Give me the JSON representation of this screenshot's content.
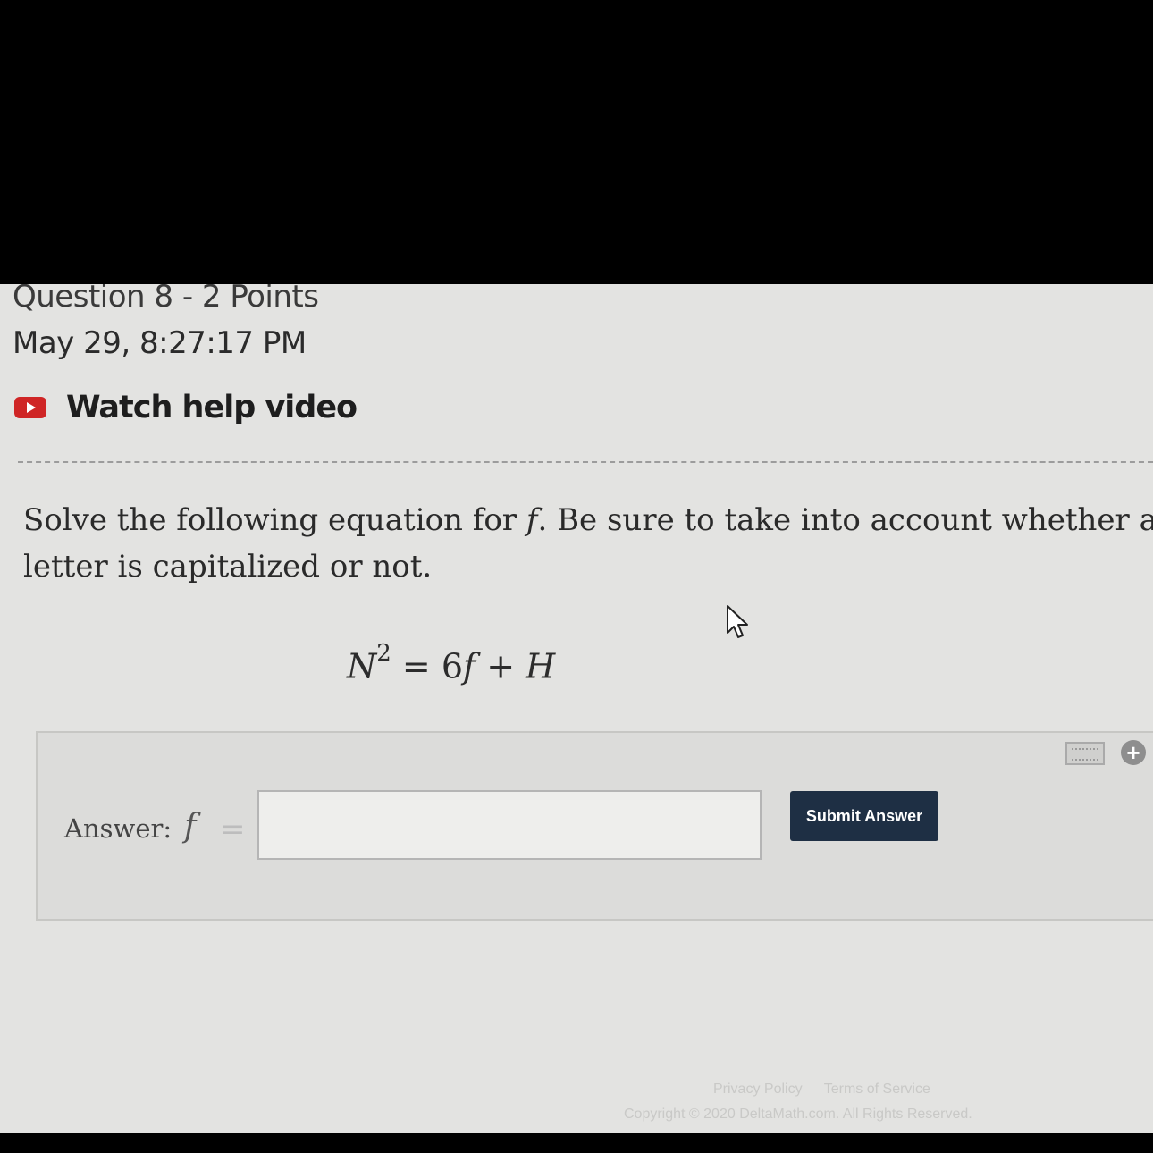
{
  "header": {
    "question_title": "Question 8 - 2 Points",
    "timestamp": "May 29, 8:27:17 PM",
    "help_link": "Watch help video"
  },
  "question": {
    "text_before_var": "Solve the following equation for ",
    "variable": "f",
    "text_after_var": ". Be sure to take into account whether a letter is capitalized or not."
  },
  "equation": {
    "lhs_base": "N",
    "lhs_exp": "2",
    "equals": "=",
    "coef": "6",
    "var": "f",
    "plus": "+",
    "const": "H"
  },
  "answer": {
    "label": "Answer:",
    "variable": "f",
    "equals": "=",
    "value": "",
    "submit_label": "Submit Answer"
  },
  "footer": {
    "privacy": "Privacy Policy",
    "terms": "Terms of Service",
    "copyright": "Copyright © 2020 DeltaMath.com. All Rights Reserved."
  },
  "colors": {
    "submit_bg": "#1e2f44",
    "youtube_red": "#cf2525",
    "screen_bg": "#e3e3e1"
  },
  "icons": [
    "youtube-play-icon",
    "keyboard-icon",
    "plus-circle-icon",
    "mouse-pointer-icon"
  ]
}
